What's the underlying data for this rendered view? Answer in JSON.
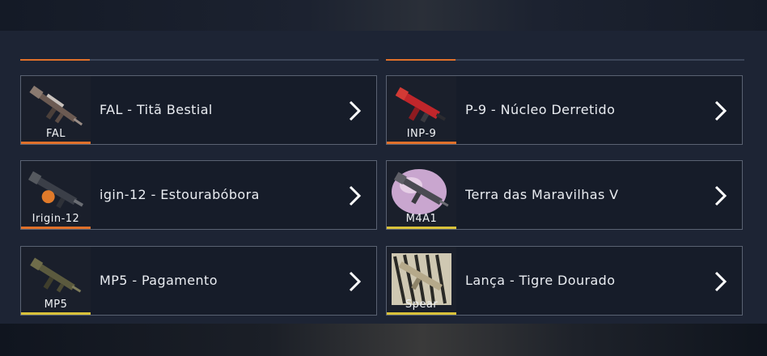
{
  "colors": {
    "orange": "#e0702a",
    "yellow": "#d9c23a"
  },
  "cards": [
    {
      "thumb_label": "FAL",
      "title": "FAL - Titã Bestial",
      "rarity": "#e0702a",
      "icon": "rifle-fal-icon"
    },
    {
      "thumb_label": "INP-9",
      "title": "P-9 - Núcleo Derretido",
      "rarity": "#e0702a",
      "icon": "smg-red-icon"
    },
    {
      "thumb_label": "Irigin-12",
      "title": "igin-12 - Estourabóbora",
      "rarity": "#e0702a",
      "icon": "shotgun-pumpkin-icon"
    },
    {
      "thumb_label": "M4A1",
      "title": "Terra das Maravilhas V",
      "rarity": "#d9c23a",
      "icon": "rifle-wonderland-icon"
    },
    {
      "thumb_label": "MP5",
      "title": "MP5 - Pagamento",
      "rarity": "#d9c23a",
      "icon": "smg-payment-icon"
    },
    {
      "thumb_label": "Spear",
      "title": "Lança - Tigre Dourado",
      "rarity": "#d9c23a",
      "icon": "rifle-tiger-icon"
    }
  ]
}
